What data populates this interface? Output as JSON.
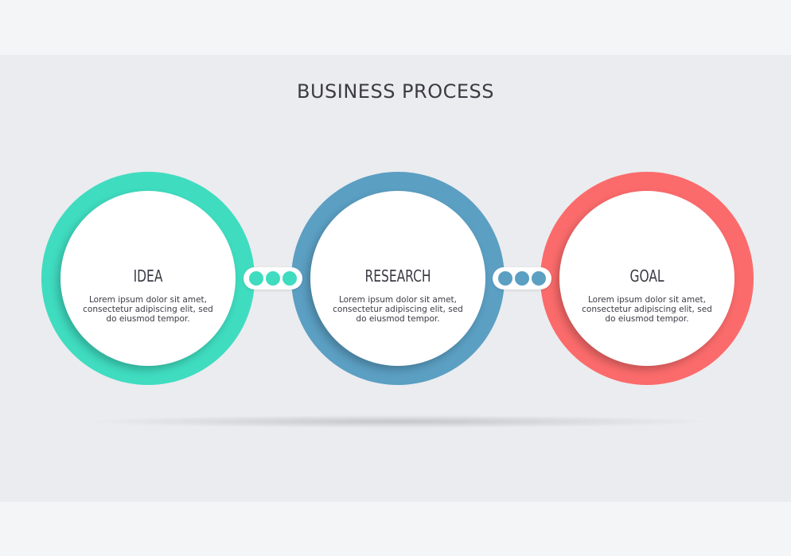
{
  "title": "BUSINESS PROCESS",
  "steps": [
    {
      "title": "IDEA",
      "text": "Lorem ipsum dolor sit amet,\nconsectetur adipiscing elit, sed\ndo eiusmod tempor.",
      "color": "#3fdcc0"
    },
    {
      "title": "RESEARCH",
      "text": "Lorem ipsum dolor sit amet,\nconsectetur adipiscing elit, sed\ndo eiusmod tempor.",
      "color": "#5b9fc3"
    },
    {
      "title": "GOAL",
      "text": "Lorem ipsum dolor sit amet,\nconsectetur adipiscing elit, sed\ndo eiusmod tempor.",
      "color": "#fb6b6b"
    }
  ],
  "connectors": [
    {
      "from": "IDEA",
      "to": "RESEARCH",
      "dot_color": "#3fdcc0"
    },
    {
      "from": "RESEARCH",
      "to": "GOAL",
      "dot_color": "#5b9fc3"
    }
  ],
  "colors": {
    "background": "#f4f5f7",
    "band": "#ebecef",
    "text": "#3d3a44"
  }
}
